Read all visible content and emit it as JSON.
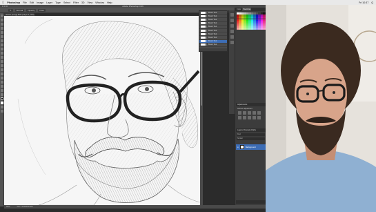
{
  "menubar": {
    "app_name": "Photoshop",
    "items": [
      "File",
      "Edit",
      "Image",
      "Layer",
      "Type",
      "Select",
      "Filter",
      "3D",
      "View",
      "Window",
      "Help"
    ],
    "status": [
      "Fri 10:37",
      "Q"
    ]
  },
  "window": {
    "title": "Adobe Photoshop CS6"
  },
  "options": {
    "mode": "Normal",
    "opacity": "Opacity",
    "flow": "Flow"
  },
  "document": {
    "tab_label": "sketch.psd @ 50% (Layer 1, Gray/8)"
  },
  "status_bar": {
    "zoom": "50%",
    "doc": "Doc: 48.6M/96.3M"
  },
  "brush_panel": {
    "presets": [
      "Brush Tool",
      "Brush Tool",
      "Brush Tool",
      "Brush Tool",
      "Brush Tool",
      "Brush Tool",
      "Brush Tool",
      "Brush Tool",
      "Brush Tool",
      "Brush Tool"
    ],
    "selected_index": 8
  },
  "right_dock": {
    "tabs": [
      "Color",
      "Swatches"
    ],
    "adjustments_title": "Adjustments",
    "adjustments_sub": "Add an adjustment",
    "layers_tabs": [
      "Layers",
      "Channels",
      "Paths"
    ],
    "layers_controls": [
      "Kind",
      "Normal",
      "Lock:"
    ],
    "layer_name": "Background"
  },
  "colors": {
    "selection": "#3d6db5",
    "panel": "#3c3c3c",
    "canvas": "#f6f6f6"
  },
  "icons": [
    "apple-icon",
    "eye-icon",
    "brush-icon"
  ]
}
